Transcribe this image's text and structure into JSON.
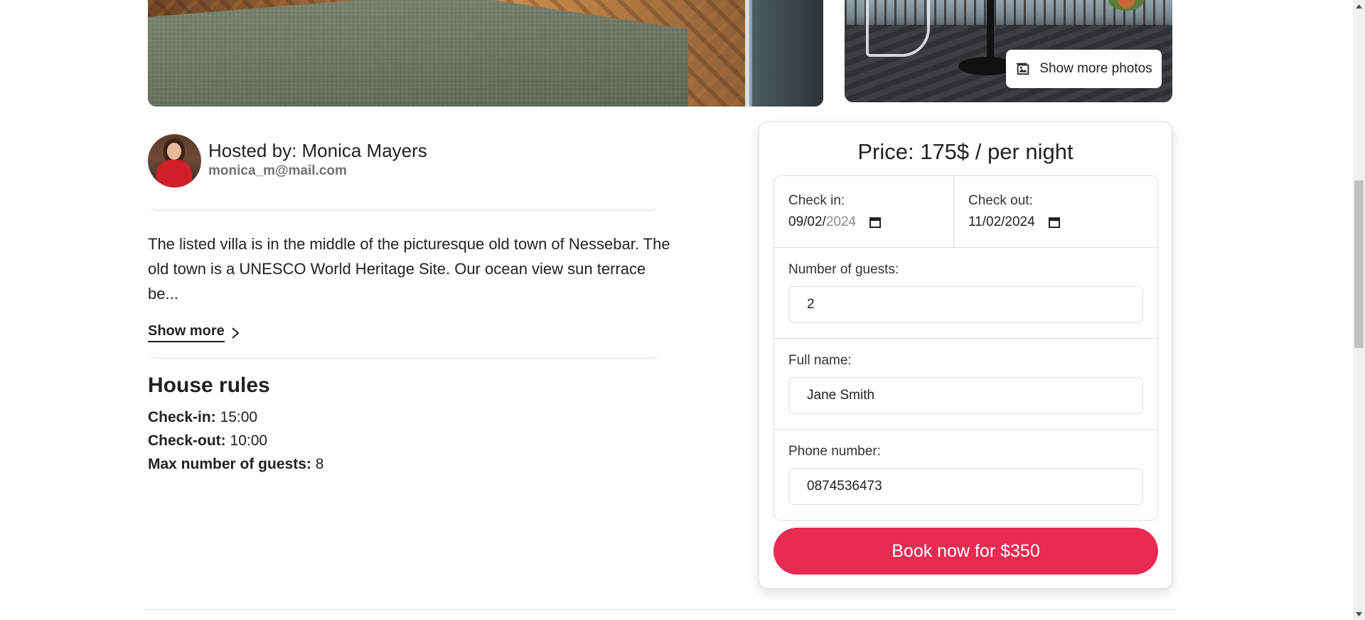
{
  "gallery": {
    "show_photos_label": "Show more photos"
  },
  "host": {
    "name": "Hosted by: Monica Mayers",
    "email": "monica_m@mail.com"
  },
  "description": {
    "text": "The listed villa is in the middle of the picturesque old town of Nessebar. The old town is a UNESCO World Heritage Site. Our ocean view sun terrace be...",
    "show_more_label": "Show more"
  },
  "house_rules": {
    "title": "House rules",
    "items": [
      {
        "label": "Check-in:",
        "value": "15:00"
      },
      {
        "label": "Check-out:",
        "value": "10:00"
      },
      {
        "label": "Max number of guests:",
        "value": "8"
      }
    ]
  },
  "booking": {
    "price": "Price: 175$ / per night",
    "check_in": {
      "label": "Check in:",
      "value_main": "09/02/",
      "value_muted": "2024"
    },
    "check_out": {
      "label": "Check out:",
      "value": "11/02/2024"
    },
    "guests": {
      "label": "Number of guests:",
      "value": "2"
    },
    "full_name": {
      "label": "Full name:",
      "value": "Jane Smith"
    },
    "phone": {
      "label": "Phone number:",
      "value": "0874536473"
    },
    "book_button": "Book now for $350"
  },
  "colors": {
    "accent": "#ea2a51",
    "text": "#222222",
    "muted": "#717171",
    "border": "#dddddd"
  },
  "icons": [
    "image-icon",
    "chevron-right-icon",
    "calendar-icon",
    "scroll-up-icon",
    "scroll-down-icon"
  ]
}
